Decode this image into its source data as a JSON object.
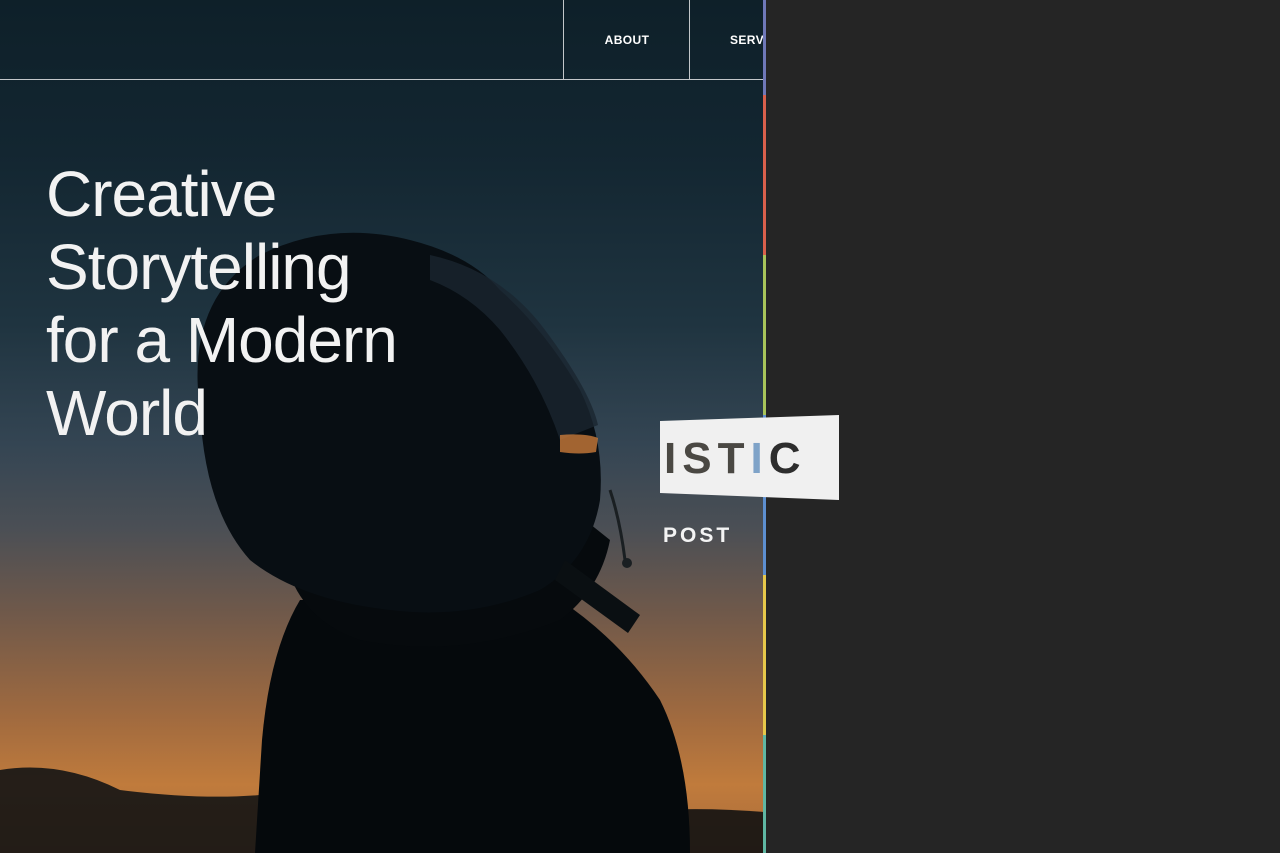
{
  "nav": {
    "items": [
      {
        "label": "ABOUT"
      },
      {
        "label": "SERV"
      }
    ]
  },
  "hero": {
    "headline_lines": [
      "Creative",
      "Storytelling",
      "for a Modern",
      "World"
    ]
  },
  "logo": {
    "text_part1": "IST",
    "text_part2": "I",
    "text_part3": "C",
    "sub_label": "POST"
  },
  "colors": {
    "headline": "#f2f2f2",
    "strip": [
      "#6f78b8",
      "#d9604c",
      "#a8c45a",
      "#5d8fd0",
      "#e7c84a",
      "#5fb7a3"
    ]
  }
}
